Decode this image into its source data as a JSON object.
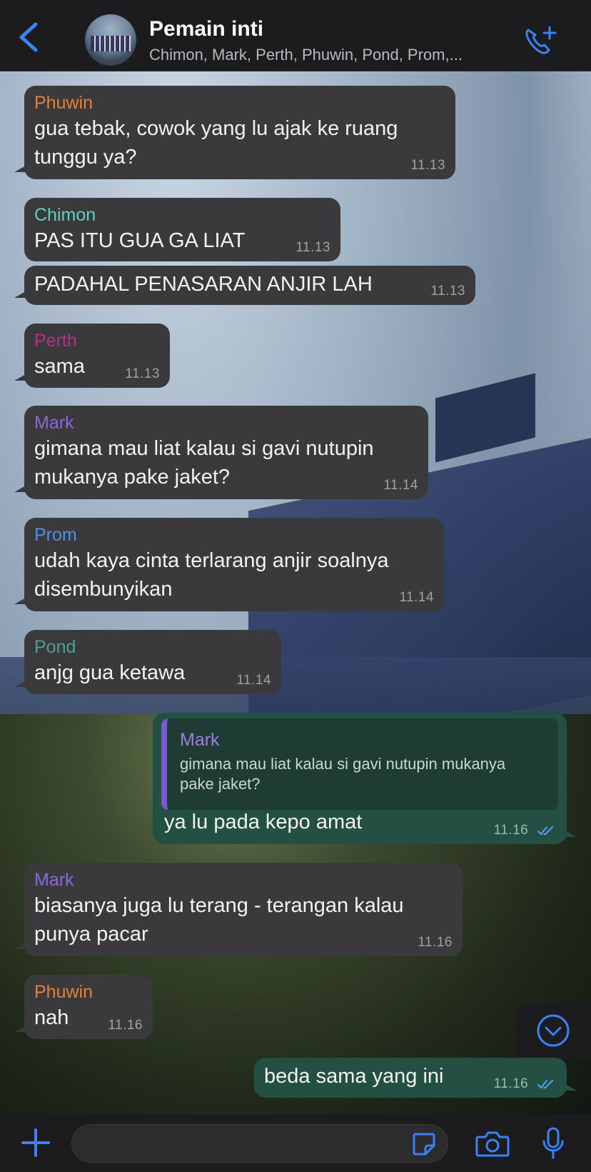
{
  "header": {
    "title": "Pemain inti",
    "subtitle": "Chimon, Mark, Perth, Phuwin, Pond, Prom,..."
  },
  "colors": {
    "accent": "#3b82f6",
    "incoming_bubble": "#3a3a3c",
    "outgoing_bubble": "#245043",
    "phuwin": "#e0813c",
    "chimon": "#5ccfc0",
    "perth": "#b32f8c",
    "mark": "#8a68dc",
    "prom": "#4f8fe8",
    "pond": "#4f9e91"
  },
  "messages": [
    {
      "sender": "Phuwin",
      "text_lines": [
        "gua tebak, cowok yang lu ajak ke ruang",
        "tunggu ya?"
      ],
      "time": "11.13"
    },
    {
      "sender": "Chimon",
      "text_lines": [
        "PAS ITU GUA GA LIAT"
      ],
      "time": "11.13"
    },
    {
      "sender": "",
      "text_lines": [
        "PADAHAL PENASARAN ANJIR LAH"
      ],
      "time": "11.13"
    },
    {
      "sender": "Perth",
      "text_lines": [
        "sama"
      ],
      "time": "11.13"
    },
    {
      "sender": "Mark",
      "text_lines": [
        "gimana mau liat kalau si gavi nutupin",
        "mukanya pake jaket?"
      ],
      "time": "11.14"
    },
    {
      "sender": "Prom",
      "text_lines": [
        "udah kaya cinta terlarang anjir soalnya",
        "disembunyikan"
      ],
      "time": "11.14"
    },
    {
      "sender": "Pond",
      "text_lines": [
        "anjg gua ketawa"
      ],
      "time": "11.14"
    },
    {
      "sender": "",
      "quote_sender": "Mark",
      "quote_lines": [
        "gimana mau liat kalau si gavi nutupin mukanya",
        "pake jaket?"
      ],
      "text_lines": [
        "ya lu pada kepo amat"
      ],
      "time": "11.16"
    },
    {
      "sender": "Mark",
      "text_lines": [
        "biasanya juga lu terang - terangan kalau",
        "punya pacar"
      ],
      "time": "11.16"
    },
    {
      "sender": "Phuwin",
      "text_lines": [
        "nah"
      ],
      "time": "11.16"
    },
    {
      "sender": "",
      "text_lines": [
        "beda sama yang ini"
      ],
      "time": "11.16"
    }
  ],
  "icons": {
    "back": "chevron-left-icon",
    "call": "phone-plus-icon",
    "scroll": "chevron-down-circle-icon",
    "plus": "plus-icon",
    "sticker": "sticker-icon",
    "camera": "camera-icon",
    "mic": "microphone-icon"
  }
}
